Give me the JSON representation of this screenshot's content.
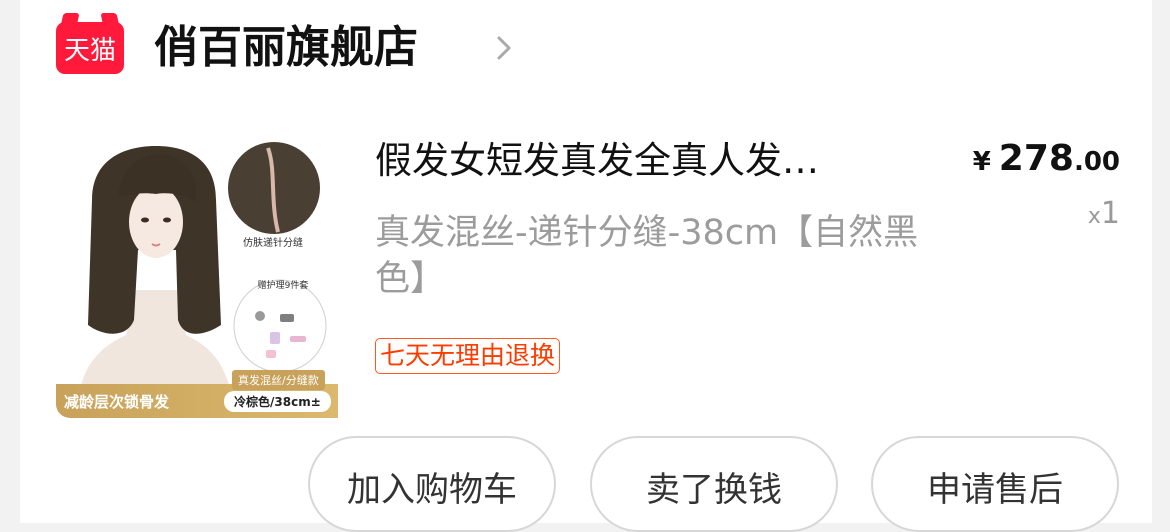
{
  "store": {
    "badge": "天猫",
    "name": "俏百丽旗舰店"
  },
  "product": {
    "title": "假发女短发真发全真人发…",
    "price_symbol": "¥",
    "price_integer": "278",
    "price_decimal": ".00",
    "quantity_prefix": "x",
    "quantity": "1",
    "sku": "真发混丝-递针分缝-38cm【自然黑色】",
    "return_policy": "七天无理由退换",
    "image": {
      "detail_label": "仿肤递针分缝",
      "gift_label": "赠护理9件套",
      "banner_text": "减龄层次锁骨发",
      "style_tag": "真发混丝/分缝款",
      "spec_pill": "冷棕色/38cm±"
    }
  },
  "actions": {
    "add_to_cart": "加入购物车",
    "resell": "卖了换钱",
    "after_sales": "申请售后"
  },
  "colors": {
    "tmall_red": "#ff1a3c",
    "return_tag_orange": "#ff3c00",
    "banner_gold": "#c8a25a"
  }
}
